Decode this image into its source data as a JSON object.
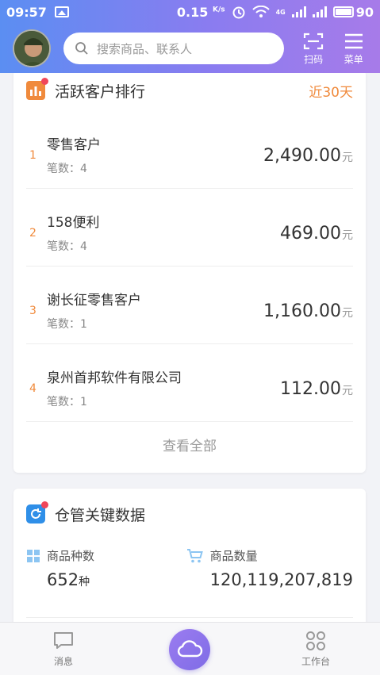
{
  "status_bar": {
    "time": "09:57",
    "speed": "0.15",
    "speed_unit": "K/s",
    "network": "4G",
    "battery": "90"
  },
  "header": {
    "search_placeholder": "搜索商品、联系人",
    "scan_label": "扫码",
    "menu_label": "菜单"
  },
  "active_customers": {
    "title": "活跃客户排行",
    "range": "近30天",
    "count_prefix": "笔数：",
    "items": [
      {
        "rank": "1",
        "name": "零售客户",
        "count": "4",
        "amount": "2,490.00",
        "unit": "元"
      },
      {
        "rank": "2",
        "name": "158便利",
        "count": "4",
        "amount": "469.00",
        "unit": "元"
      },
      {
        "rank": "3",
        "name": "谢长征零售客户",
        "count": "1",
        "amount": "1,160.00",
        "unit": "元"
      },
      {
        "rank": "4",
        "name": "泉州首邦软件有限公司",
        "count": "1",
        "amount": "112.00",
        "unit": "元"
      }
    ],
    "view_all": "查看全部"
  },
  "warehouse": {
    "title": "仓管关键数据",
    "stats": [
      {
        "label": "商品种数",
        "value": "652",
        "unit": "种"
      },
      {
        "label": "商品数量",
        "value": "120,119,207,819",
        "unit": ""
      }
    ]
  },
  "tabbar": {
    "messages": "消息",
    "workbench": "工作台"
  },
  "colors": {
    "accent": "#f08a3c",
    "badge": "#f0465a",
    "gradient_start": "#5b8ef2",
    "gradient_end": "#a77be9",
    "center_tab": "#8b74ea"
  }
}
